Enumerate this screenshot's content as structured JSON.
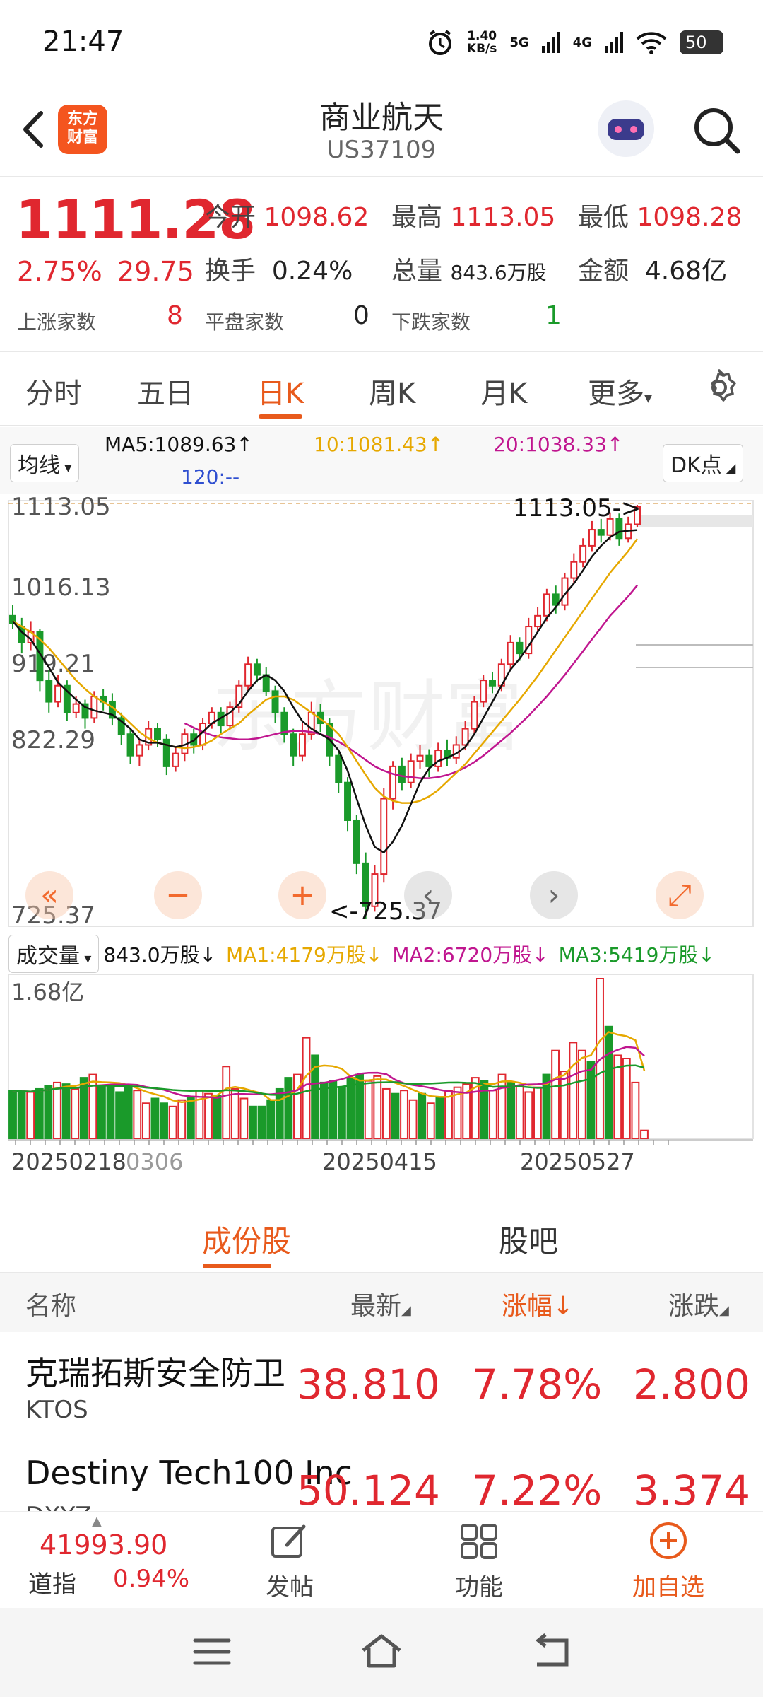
{
  "status": {
    "time": "21:47",
    "speed_top": "1.40",
    "speed_unit": "KB/s",
    "net1": "5G",
    "net2": "4G",
    "battery": "50"
  },
  "header": {
    "logo_line1": "东方",
    "logo_line2": "财富",
    "title": "商业航天",
    "code": "US37109"
  },
  "quote": {
    "price": "1111.28",
    "change_pct": "2.75%",
    "change_amt": "29.75",
    "open_label": "今开",
    "open": "1098.62",
    "high_label": "最高",
    "high": "1113.05",
    "low_label": "最低",
    "low": "1098.28",
    "turnover_label": "换手",
    "turnover": "0.24%",
    "volume_label": "总量",
    "volume": "843.6万股",
    "amount_label": "金额",
    "amount": "4.68亿",
    "up_label": "上涨家数",
    "up": "8",
    "flat_label": "平盘家数",
    "flat": "0",
    "down_label": "下跌家数",
    "down": "1"
  },
  "tabs": [
    "分时",
    "五日",
    "日K",
    "周K",
    "月K",
    "更多"
  ],
  "ma": {
    "selector": "均线",
    "ma5": "MA5:1089.63↑",
    "ma10": "10:1081.43↑",
    "ma20": "20:1038.33↑",
    "ma120": "120:--",
    "dk": "DK点",
    "color5": "#111111",
    "color10": "#e6a800",
    "color20": "#c0168f",
    "color120": "#2f4fd0"
  },
  "chart_data": {
    "type": "candlestick",
    "y_ticks": [
      "1113.05",
      "1016.13",
      "919.21",
      "822.29",
      "725.37"
    ],
    "high_label": "1113.05->",
    "low_label": "<-725.37",
    "ylim": [
      725.37,
      1113.05
    ],
    "x_ticks": [
      "20250218",
      "0306",
      "20250415",
      "20250527"
    ],
    "candles": [
      [
        1010,
        1003,
        1020,
        998
      ],
      [
        1000,
        985,
        1008,
        975
      ],
      [
        985,
        995,
        1005,
        978
      ],
      [
        995,
        950,
        998,
        940
      ],
      [
        950,
        930,
        960,
        920
      ],
      [
        930,
        945,
        955,
        925
      ],
      [
        945,
        920,
        950,
        912
      ],
      [
        920,
        928,
        935,
        915
      ],
      [
        928,
        915,
        932,
        905
      ],
      [
        915,
        935,
        940,
        910
      ],
      [
        935,
        930,
        942,
        922
      ],
      [
        930,
        915,
        938,
        908
      ],
      [
        915,
        900,
        920,
        890
      ],
      [
        900,
        880,
        905,
        872
      ],
      [
        880,
        890,
        895,
        870
      ],
      [
        890,
        905,
        912,
        885
      ],
      [
        905,
        895,
        910,
        888
      ],
      [
        895,
        870,
        900,
        862
      ],
      [
        870,
        882,
        888,
        865
      ],
      [
        882,
        900,
        905,
        875
      ],
      [
        900,
        890,
        905,
        882
      ],
      [
        890,
        910,
        915,
        885
      ],
      [
        910,
        920,
        925,
        905
      ],
      [
        920,
        908,
        925,
        900
      ],
      [
        908,
        925,
        930,
        905
      ],
      [
        925,
        945,
        950,
        920
      ],
      [
        945,
        965,
        972,
        940
      ],
      [
        965,
        955,
        970,
        948
      ],
      [
        955,
        940,
        962,
        935
      ],
      [
        940,
        920,
        945,
        910
      ],
      [
        920,
        900,
        925,
        892
      ],
      [
        900,
        880,
        905,
        870
      ],
      [
        880,
        900,
        910,
        875
      ],
      [
        900,
        920,
        930,
        895
      ],
      [
        920,
        910,
        928,
        902
      ],
      [
        910,
        880,
        915,
        870
      ],
      [
        880,
        855,
        885,
        845
      ],
      [
        855,
        820,
        860,
        810
      ],
      [
        820,
        780,
        825,
        770
      ],
      [
        780,
        740,
        790,
        728
      ],
      [
        740,
        770,
        778,
        735
      ],
      [
        770,
        840,
        850,
        762
      ],
      [
        840,
        870,
        875,
        830
      ],
      [
        870,
        855,
        878,
        848
      ],
      [
        855,
        875,
        882,
        850
      ],
      [
        875,
        880,
        890,
        868
      ],
      [
        880,
        870,
        886,
        860
      ],
      [
        870,
        885,
        892,
        865
      ],
      [
        885,
        878,
        895,
        870
      ],
      [
        878,
        890,
        898,
        872
      ],
      [
        890,
        905,
        912,
        885
      ],
      [
        905,
        930,
        935,
        900
      ],
      [
        930,
        950,
        955,
        925
      ],
      [
        950,
        945,
        958,
        938
      ],
      [
        945,
        965,
        970,
        940
      ],
      [
        965,
        985,
        992,
        960
      ],
      [
        985,
        975,
        990,
        968
      ],
      [
        975,
        1000,
        1008,
        970
      ],
      [
        1000,
        1010,
        1018,
        995
      ],
      [
        1010,
        1030,
        1035,
        1005
      ],
      [
        1030,
        1020,
        1038,
        1012
      ],
      [
        1020,
        1045,
        1050,
        1015
      ],
      [
        1045,
        1060,
        1068,
        1040
      ],
      [
        1060,
        1075,
        1082,
        1055
      ],
      [
        1075,
        1090,
        1098,
        1070
      ],
      [
        1090,
        1085,
        1100,
        1078
      ],
      [
        1085,
        1100,
        1106,
        1080
      ],
      [
        1100,
        1082,
        1105,
        1075
      ],
      [
        1082,
        1095,
        1102,
        1078
      ],
      [
        1095,
        1111.28,
        1113.05,
        1092
      ]
    ],
    "ma5": [
      1005,
      995,
      988,
      975,
      962,
      948,
      940,
      932,
      925,
      922,
      920,
      918,
      912,
      905,
      895,
      892,
      892,
      890,
      888,
      890,
      894,
      902,
      910,
      915,
      920,
      928,
      940,
      950,
      955,
      950,
      940,
      925,
      912,
      905,
      900,
      895,
      885,
      866,
      840,
      815,
      795,
      790,
      800,
      815,
      835,
      855,
      868,
      875,
      878,
      882,
      888,
      900,
      915,
      930,
      945,
      960,
      970,
      982,
      995,
      1008,
      1018,
      1030,
      1040,
      1052,
      1065,
      1075,
      1083,
      1088,
      1089,
      1089.63
    ],
    "ma10": [
      1005,
      1000,
      995,
      988,
      980,
      970,
      960,
      950,
      942,
      935,
      930,
      925,
      918,
      910,
      902,
      896,
      892,
      890,
      888,
      887,
      888,
      890,
      894,
      900,
      905,
      910,
      918,
      925,
      932,
      935,
      935,
      932,
      926,
      920,
      914,
      908,
      900,
      888,
      875,
      862,
      850,
      842,
      838,
      836,
      836,
      838,
      842,
      848,
      856,
      864,
      872,
      882,
      892,
      902,
      912,
      922,
      932,
      943,
      954,
      966,
      978,
      990,
      1002,
      1014,
      1026,
      1038,
      1050,
      1060,
      1070,
      1081.43
    ],
    "ma20": [
      null,
      null,
      null,
      null,
      null,
      null,
      null,
      null,
      null,
      null,
      null,
      null,
      null,
      null,
      null,
      null,
      null,
      null,
      null,
      910,
      906,
      902,
      899,
      897,
      896,
      895,
      895,
      896,
      898,
      900,
      902,
      903,
      903,
      902,
      900,
      897,
      893,
      888,
      882,
      876,
      870,
      866,
      863,
      861,
      860,
      859,
      859,
      860,
      862,
      865,
      869,
      874,
      880,
      887,
      894,
      901,
      909,
      917,
      926,
      935,
      945,
      955,
      966,
      977,
      988,
      999,
      1010,
      1019,
      1028,
      1038.33
    ]
  },
  "volume": {
    "selector": "成交量",
    "cur": "843.0万股↓",
    "ma1": "MA1:4179万股↓",
    "ma2": "MA2:6720万股↓",
    "ma3": "MA3:5419万股↓",
    "top": "1.68亿",
    "values": [
      0.3,
      0.29,
      0.29,
      0.31,
      0.33,
      0.35,
      0.34,
      0.31,
      0.38,
      0.4,
      0.33,
      0.33,
      0.29,
      0.32,
      0.3,
      0.22,
      0.25,
      0.22,
      0.2,
      0.24,
      0.26,
      0.3,
      0.28,
      0.27,
      0.45,
      0.31,
      0.25,
      0.2,
      0.2,
      0.24,
      0.31,
      0.38,
      0.4,
      0.63,
      0.52,
      0.35,
      0.36,
      0.32,
      0.38,
      0.4,
      0.36,
      0.39,
      0.31,
      0.28,
      0.3,
      0.24,
      0.28,
      0.22,
      0.26,
      0.3,
      0.32,
      0.34,
      0.38,
      0.36,
      0.3,
      0.4,
      0.35,
      0.33,
      0.29,
      0.32,
      0.4,
      0.55,
      0.42,
      0.6,
      0.55,
      0.48,
      1.0,
      0.7,
      0.52,
      0.5,
      0.35,
      0.05
    ]
  },
  "sections": {
    "tab1": "成份股",
    "tab2": "股吧"
  },
  "table": {
    "headers": {
      "name": "名称",
      "latest": "最新",
      "pct": "涨幅",
      "chg": "涨跌"
    },
    "rows": [
      {
        "name": "克瑞拓斯安全防卫",
        "code": "KTOS",
        "latest": "38.810",
        "pct": "7.78%",
        "chg": "2.800"
      },
      {
        "name": "Destiny Tech100 Inc",
        "code": "DXYZ",
        "latest": "50.124",
        "pct": "7.22%",
        "chg": "3.374"
      }
    ]
  },
  "bottom": {
    "index_value": "41993.90",
    "index_name": "道指",
    "index_pct": "0.94%",
    "post": "发帖",
    "func": "功能",
    "add": "加自选"
  }
}
